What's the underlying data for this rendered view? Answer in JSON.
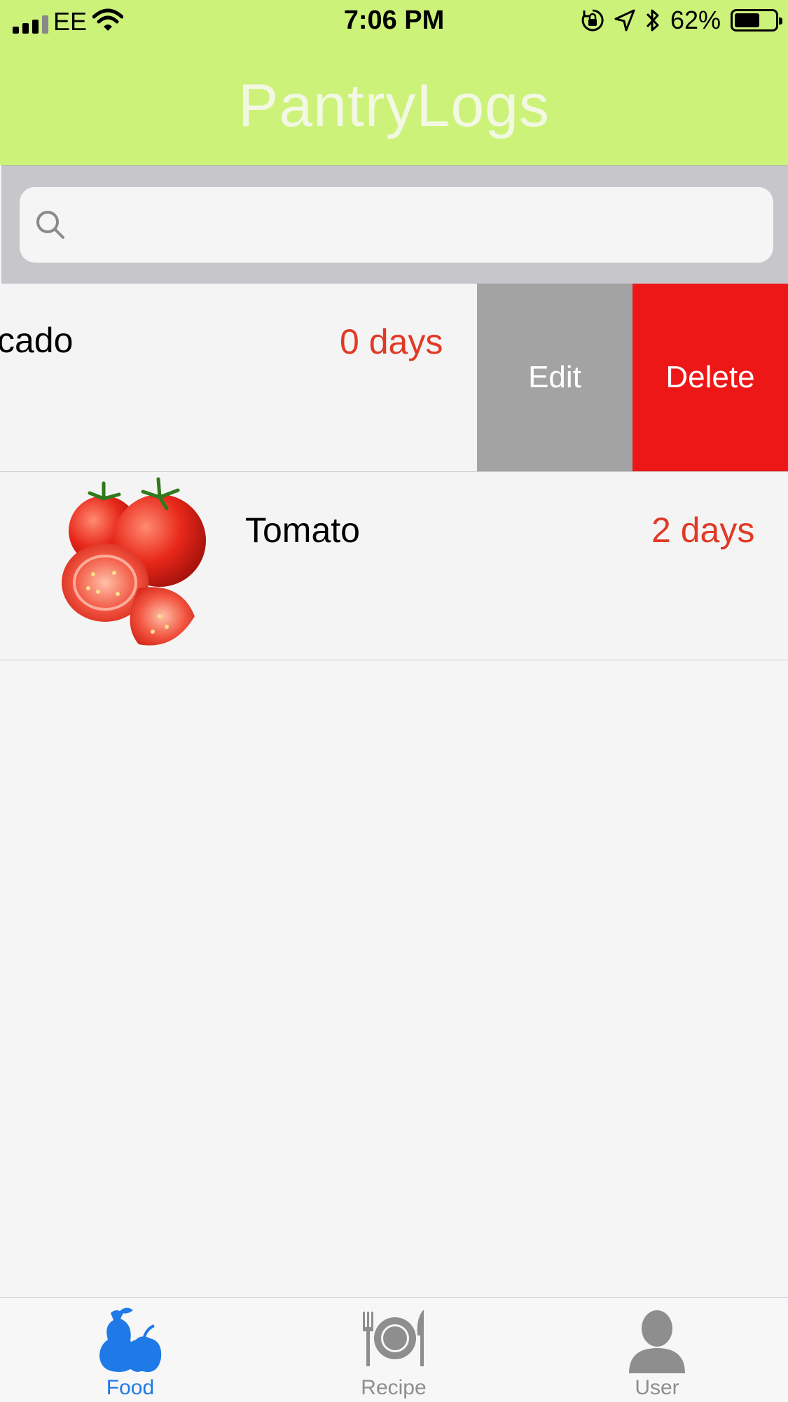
{
  "status_bar": {
    "carrier": "EE",
    "time": "7:06 PM",
    "battery_percent": "62%",
    "battery_level": 0.62,
    "icons": [
      "signal-icon",
      "wifi-icon",
      "rotation-lock-icon",
      "location-icon",
      "bluetooth-icon",
      "battery-icon"
    ]
  },
  "nav": {
    "title": "PantryLogs"
  },
  "search": {
    "placeholder": "",
    "value": ""
  },
  "list": {
    "items": [
      {
        "name": "cado",
        "days": "0 days",
        "actions": {
          "edit": "Edit",
          "delete": "Delete"
        }
      },
      {
        "name": "Tomato",
        "days": "2 days",
        "image_icon": "tomato-image"
      }
    ]
  },
  "tabbar": {
    "tabs": [
      {
        "label": "Food",
        "icon": "food-icon",
        "selected": true
      },
      {
        "label": "Recipe",
        "icon": "recipe-icon",
        "selected": false
      },
      {
        "label": "User",
        "icon": "user-icon",
        "selected": false
      }
    ]
  },
  "colors": {
    "nav_bg": "#ccf27a",
    "days_text": "#e03a26",
    "delete_bg": "#ee1717",
    "edit_bg": "#a3a3a3",
    "tab_selected": "#1f7ae8",
    "tab_unselected": "#8e8e8e"
  }
}
